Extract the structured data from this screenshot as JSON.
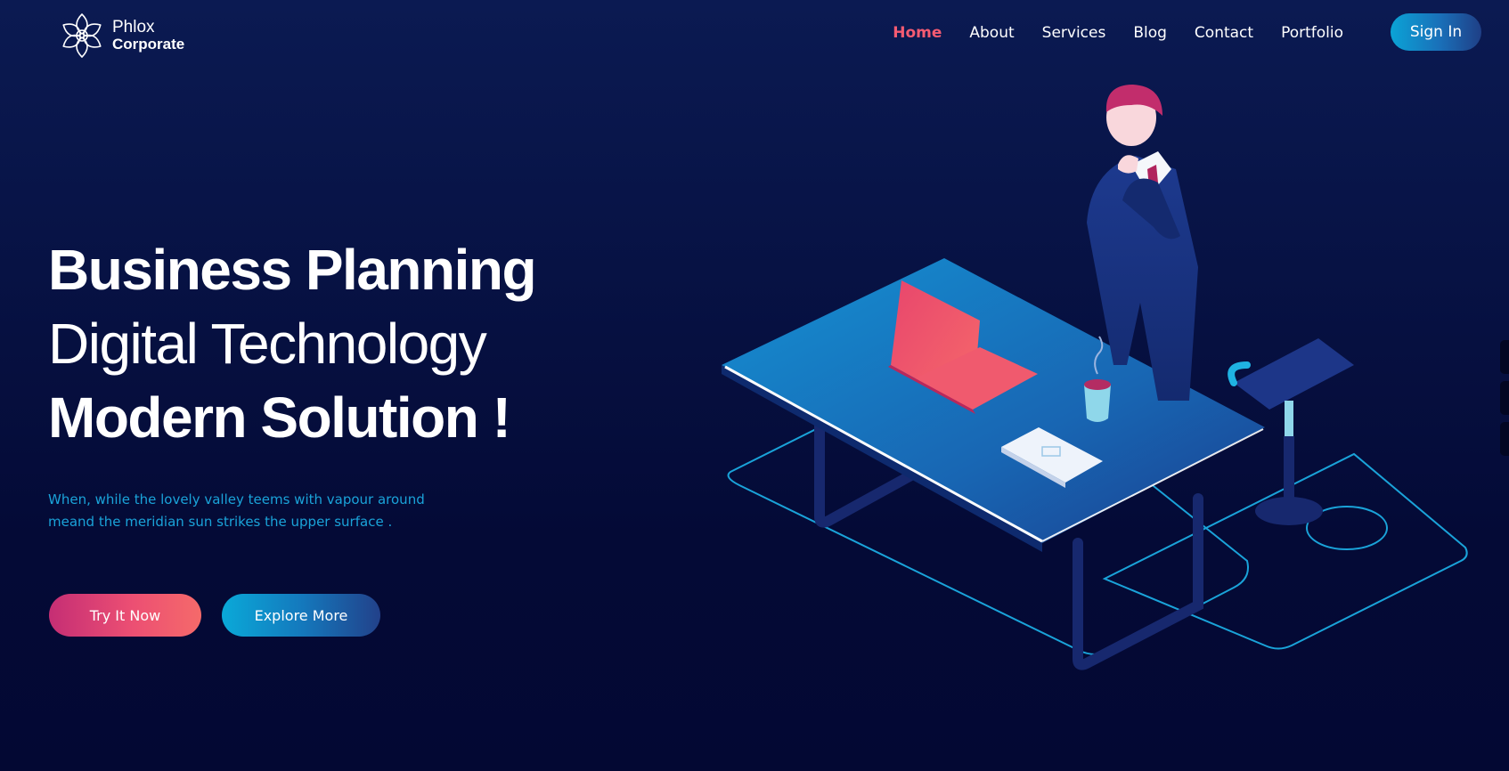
{
  "brand": {
    "name_line1": "Phlox",
    "name_line2": "Corporate",
    "icon": "flower-logo-icon"
  },
  "nav": {
    "items": [
      {
        "label": "Home",
        "active": true
      },
      {
        "label": "About",
        "active": false
      },
      {
        "label": "Services",
        "active": false
      },
      {
        "label": "Blog",
        "active": false
      },
      {
        "label": "Contact",
        "active": false
      },
      {
        "label": "Portfolio",
        "active": false
      }
    ],
    "signin_label": "Sign In"
  },
  "hero": {
    "line1": "Business Planning",
    "line2": "Digital Technology",
    "line3": "Modern Solution !",
    "subtext_line1": "When, while the lovely valley teems with vapour around",
    "subtext_line2": "meand the meridian sun strikes the upper surface .",
    "primary_button": "Try It Now",
    "secondary_button": "Explore More"
  },
  "colors": {
    "background": "#071244",
    "accent_pink": "#f45b72",
    "accent_blue": "#0ba3d6",
    "subtext": "#1aa3d9"
  },
  "illustration": {
    "subject": "isometric businessman standing by desk with laptop, coffee cup, paper and stool"
  }
}
